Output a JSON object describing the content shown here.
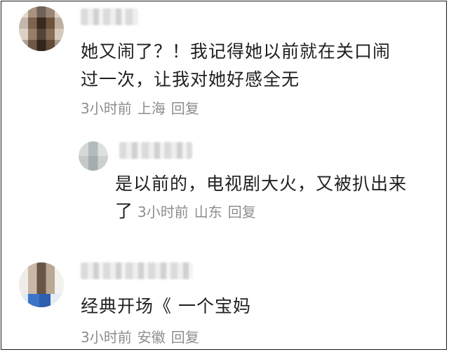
{
  "comments": [
    {
      "text_lines": [
        "她又闹了？！我记得她以前就在关口闹",
        "过一次，让我对她好感全无"
      ],
      "time": "3小时前",
      "location": "上海",
      "reply_label": "回复"
    },
    {
      "text_lines": [
        "是以前的，电视剧大火，又被扒出来",
        "了"
      ],
      "time": "3小时前",
      "location": "山东",
      "reply_label": "回复"
    },
    {
      "text_lines": [
        "经典开场《 一个宝妈"
      ],
      "time": "3小时前",
      "location": "安徽",
      "reply_label": "回复"
    }
  ]
}
